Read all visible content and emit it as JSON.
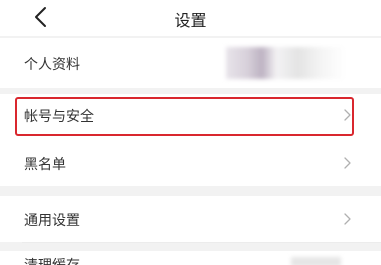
{
  "nav": {
    "title": "设置",
    "back_icon": "chevron-left-icon"
  },
  "settings": {
    "profile": {
      "label": "个人资料"
    },
    "account_security": {
      "label": "帐号与安全",
      "highlight_color": "#d9272e"
    },
    "blacklist": {
      "label": "黑名单"
    },
    "general": {
      "label": "通用设置"
    },
    "cache": {
      "label": "清理缓存"
    }
  },
  "chevron_icon": "chevron-right-icon"
}
